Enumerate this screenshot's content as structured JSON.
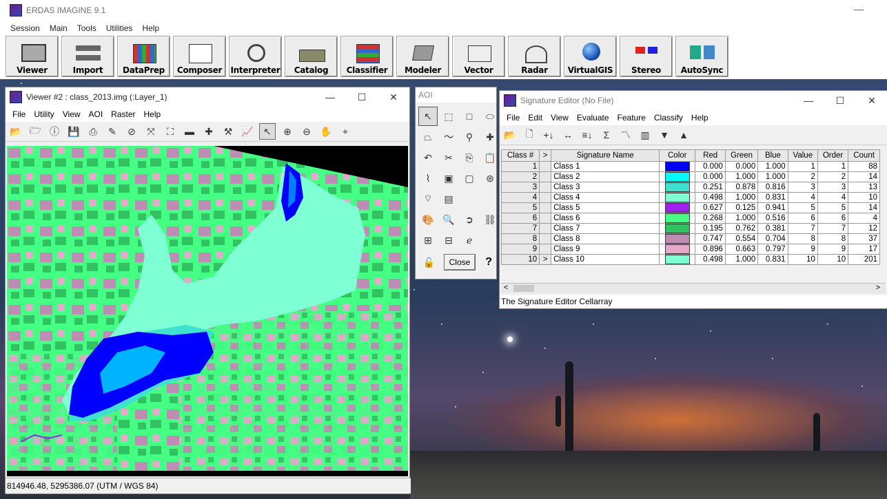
{
  "app": {
    "title": "ERDAS IMAGINE 9.1",
    "menu": [
      "Session",
      "Main",
      "Tools",
      "Utilities",
      "Help"
    ],
    "toolbar": [
      "Viewer",
      "Import",
      "DataPrep",
      "Composer",
      "Interpreter",
      "Catalog",
      "Classifier",
      "Modeler",
      "Vector",
      "Radar",
      "VirtualGIS",
      "Stereo",
      "AutoSync"
    ]
  },
  "viewer": {
    "title": "Viewer #2 : class_2013.img (:Layer_1)",
    "menu": [
      "File",
      "Utility",
      "View",
      "AOI",
      "Raster",
      "Help"
    ],
    "status": "814946.48, 5295386.07   (UTM / WGS 84)"
  },
  "aoi": {
    "title": "AOI",
    "close_label": "Close",
    "help_label": "?"
  },
  "sig": {
    "title": "Signature Editor (No File)",
    "menu": [
      "File",
      "Edit",
      "View",
      "Evaluate",
      "Feature",
      "Classify",
      "Help"
    ],
    "columns": [
      "Class #",
      ">",
      "Signature Name",
      "Color",
      "Red",
      "Green",
      "Blue",
      "Value",
      "Order",
      "Count"
    ],
    "rows": [
      {
        "id": "1",
        "name": "Class 1",
        "color": "#0000ff",
        "red": "0.000",
        "green": "0.000",
        "blue": "1.000",
        "value": "1",
        "order": "1",
        "count": "88",
        "sel": ""
      },
      {
        "id": "2",
        "name": "Class 2",
        "color": "#00ffff",
        "red": "0.000",
        "green": "1.000",
        "blue": "1.000",
        "value": "2",
        "order": "2",
        "count": "14",
        "sel": ""
      },
      {
        "id": "3",
        "name": "Class 3",
        "color": "#40e0d0",
        "red": "0.251",
        "green": "0.878",
        "blue": "0.816",
        "value": "3",
        "order": "3",
        "count": "13",
        "sel": ""
      },
      {
        "id": "4",
        "name": "Class 4",
        "color": "#7fffd4",
        "red": "0.498",
        "green": "1.000",
        "blue": "0.831",
        "value": "4",
        "order": "4",
        "count": "10",
        "sel": ""
      },
      {
        "id": "5",
        "name": "Class 5",
        "color": "#a020f0",
        "red": "0.627",
        "green": "0.125",
        "blue": "0.941",
        "value": "5",
        "order": "5",
        "count": "14",
        "sel": ""
      },
      {
        "id": "6",
        "name": "Class 6",
        "color": "#44ff84",
        "red": "0.268",
        "green": "1.000",
        "blue": "0.516",
        "value": "6",
        "order": "6",
        "count": "4",
        "sel": ""
      },
      {
        "id": "7",
        "name": "Class 7",
        "color": "#32c261",
        "red": "0.195",
        "green": "0.762",
        "blue": "0.381",
        "value": "7",
        "order": "7",
        "count": "12",
        "sel": ""
      },
      {
        "id": "8",
        "name": "Class 8",
        "color": "#be8db3",
        "red": "0.747",
        "green": "0.554",
        "blue": "0.704",
        "value": "8",
        "order": "8",
        "count": "37",
        "sel": ""
      },
      {
        "id": "9",
        "name": "Class 9",
        "color": "#e4a9cb",
        "red": "0.896",
        "green": "0.663",
        "blue": "0.797",
        "value": "9",
        "order": "9",
        "count": "17",
        "sel": ""
      },
      {
        "id": "10",
        "name": "Class 10",
        "color": "#7fffd4",
        "red": "0.498",
        "green": "1.000",
        "blue": "0.831",
        "value": "10",
        "order": "10",
        "count": "201",
        "sel": ">"
      }
    ],
    "status": "The Signature Editor Cellarray"
  }
}
